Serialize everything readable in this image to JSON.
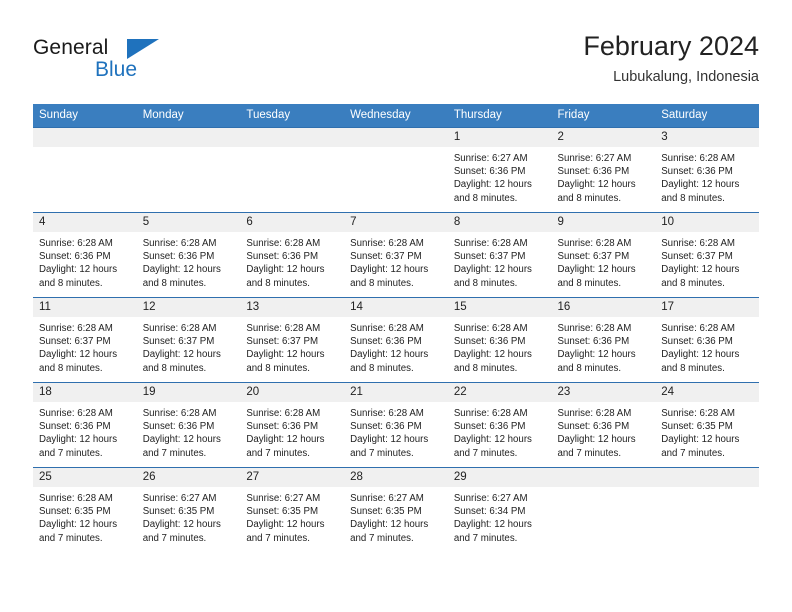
{
  "brand": {
    "name_part1": "General",
    "name_part2": "Blue",
    "logo_icon": "triangle-logo-icon"
  },
  "header": {
    "month_title": "February 2024",
    "location": "Lubukalung, Indonesia"
  },
  "calendar": {
    "weekday_headers": [
      "Sunday",
      "Monday",
      "Tuesday",
      "Wednesday",
      "Thursday",
      "Friday",
      "Saturday"
    ],
    "accent_color": "#3a7ebf",
    "border_color": "#2f6fae",
    "daynum_bg": "#f0f0f0",
    "weeks": [
      [
        {
          "day": "",
          "empty": true
        },
        {
          "day": "",
          "empty": true
        },
        {
          "day": "",
          "empty": true
        },
        {
          "day": "",
          "empty": true
        },
        {
          "day": "1",
          "sunrise": "Sunrise: 6:27 AM",
          "sunset": "Sunset: 6:36 PM",
          "daylight_line1": "Daylight: 12 hours",
          "daylight_line2": "and 8 minutes."
        },
        {
          "day": "2",
          "sunrise": "Sunrise: 6:27 AM",
          "sunset": "Sunset: 6:36 PM",
          "daylight_line1": "Daylight: 12 hours",
          "daylight_line2": "and 8 minutes."
        },
        {
          "day": "3",
          "sunrise": "Sunrise: 6:28 AM",
          "sunset": "Sunset: 6:36 PM",
          "daylight_line1": "Daylight: 12 hours",
          "daylight_line2": "and 8 minutes."
        }
      ],
      [
        {
          "day": "4",
          "sunrise": "Sunrise: 6:28 AM",
          "sunset": "Sunset: 6:36 PM",
          "daylight_line1": "Daylight: 12 hours",
          "daylight_line2": "and 8 minutes."
        },
        {
          "day": "5",
          "sunrise": "Sunrise: 6:28 AM",
          "sunset": "Sunset: 6:36 PM",
          "daylight_line1": "Daylight: 12 hours",
          "daylight_line2": "and 8 minutes."
        },
        {
          "day": "6",
          "sunrise": "Sunrise: 6:28 AM",
          "sunset": "Sunset: 6:36 PM",
          "daylight_line1": "Daylight: 12 hours",
          "daylight_line2": "and 8 minutes."
        },
        {
          "day": "7",
          "sunrise": "Sunrise: 6:28 AM",
          "sunset": "Sunset: 6:37 PM",
          "daylight_line1": "Daylight: 12 hours",
          "daylight_line2": "and 8 minutes."
        },
        {
          "day": "8",
          "sunrise": "Sunrise: 6:28 AM",
          "sunset": "Sunset: 6:37 PM",
          "daylight_line1": "Daylight: 12 hours",
          "daylight_line2": "and 8 minutes."
        },
        {
          "day": "9",
          "sunrise": "Sunrise: 6:28 AM",
          "sunset": "Sunset: 6:37 PM",
          "daylight_line1": "Daylight: 12 hours",
          "daylight_line2": "and 8 minutes."
        },
        {
          "day": "10",
          "sunrise": "Sunrise: 6:28 AM",
          "sunset": "Sunset: 6:37 PM",
          "daylight_line1": "Daylight: 12 hours",
          "daylight_line2": "and 8 minutes."
        }
      ],
      [
        {
          "day": "11",
          "sunrise": "Sunrise: 6:28 AM",
          "sunset": "Sunset: 6:37 PM",
          "daylight_line1": "Daylight: 12 hours",
          "daylight_line2": "and 8 minutes."
        },
        {
          "day": "12",
          "sunrise": "Sunrise: 6:28 AM",
          "sunset": "Sunset: 6:37 PM",
          "daylight_line1": "Daylight: 12 hours",
          "daylight_line2": "and 8 minutes."
        },
        {
          "day": "13",
          "sunrise": "Sunrise: 6:28 AM",
          "sunset": "Sunset: 6:37 PM",
          "daylight_line1": "Daylight: 12 hours",
          "daylight_line2": "and 8 minutes."
        },
        {
          "day": "14",
          "sunrise": "Sunrise: 6:28 AM",
          "sunset": "Sunset: 6:36 PM",
          "daylight_line1": "Daylight: 12 hours",
          "daylight_line2": "and 8 minutes."
        },
        {
          "day": "15",
          "sunrise": "Sunrise: 6:28 AM",
          "sunset": "Sunset: 6:36 PM",
          "daylight_line1": "Daylight: 12 hours",
          "daylight_line2": "and 8 minutes."
        },
        {
          "day": "16",
          "sunrise": "Sunrise: 6:28 AM",
          "sunset": "Sunset: 6:36 PM",
          "daylight_line1": "Daylight: 12 hours",
          "daylight_line2": "and 8 minutes."
        },
        {
          "day": "17",
          "sunrise": "Sunrise: 6:28 AM",
          "sunset": "Sunset: 6:36 PM",
          "daylight_line1": "Daylight: 12 hours",
          "daylight_line2": "and 8 minutes."
        }
      ],
      [
        {
          "day": "18",
          "sunrise": "Sunrise: 6:28 AM",
          "sunset": "Sunset: 6:36 PM",
          "daylight_line1": "Daylight: 12 hours",
          "daylight_line2": "and 7 minutes."
        },
        {
          "day": "19",
          "sunrise": "Sunrise: 6:28 AM",
          "sunset": "Sunset: 6:36 PM",
          "daylight_line1": "Daylight: 12 hours",
          "daylight_line2": "and 7 minutes."
        },
        {
          "day": "20",
          "sunrise": "Sunrise: 6:28 AM",
          "sunset": "Sunset: 6:36 PM",
          "daylight_line1": "Daylight: 12 hours",
          "daylight_line2": "and 7 minutes."
        },
        {
          "day": "21",
          "sunrise": "Sunrise: 6:28 AM",
          "sunset": "Sunset: 6:36 PM",
          "daylight_line1": "Daylight: 12 hours",
          "daylight_line2": "and 7 minutes."
        },
        {
          "day": "22",
          "sunrise": "Sunrise: 6:28 AM",
          "sunset": "Sunset: 6:36 PM",
          "daylight_line1": "Daylight: 12 hours",
          "daylight_line2": "and 7 minutes."
        },
        {
          "day": "23",
          "sunrise": "Sunrise: 6:28 AM",
          "sunset": "Sunset: 6:36 PM",
          "daylight_line1": "Daylight: 12 hours",
          "daylight_line2": "and 7 minutes."
        },
        {
          "day": "24",
          "sunrise": "Sunrise: 6:28 AM",
          "sunset": "Sunset: 6:35 PM",
          "daylight_line1": "Daylight: 12 hours",
          "daylight_line2": "and 7 minutes."
        }
      ],
      [
        {
          "day": "25",
          "sunrise": "Sunrise: 6:28 AM",
          "sunset": "Sunset: 6:35 PM",
          "daylight_line1": "Daylight: 12 hours",
          "daylight_line2": "and 7 minutes."
        },
        {
          "day": "26",
          "sunrise": "Sunrise: 6:27 AM",
          "sunset": "Sunset: 6:35 PM",
          "daylight_line1": "Daylight: 12 hours",
          "daylight_line2": "and 7 minutes."
        },
        {
          "day": "27",
          "sunrise": "Sunrise: 6:27 AM",
          "sunset": "Sunset: 6:35 PM",
          "daylight_line1": "Daylight: 12 hours",
          "daylight_line2": "and 7 minutes."
        },
        {
          "day": "28",
          "sunrise": "Sunrise: 6:27 AM",
          "sunset": "Sunset: 6:35 PM",
          "daylight_line1": "Daylight: 12 hours",
          "daylight_line2": "and 7 minutes."
        },
        {
          "day": "29",
          "sunrise": "Sunrise: 6:27 AM",
          "sunset": "Sunset: 6:34 PM",
          "daylight_line1": "Daylight: 12 hours",
          "daylight_line2": "and 7 minutes."
        },
        {
          "day": "",
          "empty": true
        },
        {
          "day": "",
          "empty": true
        }
      ]
    ]
  }
}
